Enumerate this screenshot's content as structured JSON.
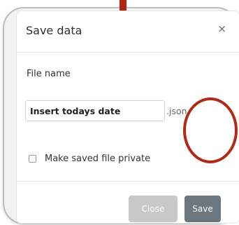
{
  "dialog": {
    "title": "Save data",
    "close_glyph": "×",
    "file_label": "File name",
    "file_name_value": "Insert todays date",
    "extension": ".json",
    "private_label": "Make saved file private",
    "private_checked": false,
    "close_button": "Close",
    "save_button": "Save"
  },
  "colors": {
    "accent": "#b5210f",
    "save_button": "#6d7780",
    "close_button_disabled": "#c8c8c8",
    "highlight_ring": "#b02a18"
  },
  "icons": {
    "close": "close-icon",
    "highlight": "highlight-circle"
  }
}
